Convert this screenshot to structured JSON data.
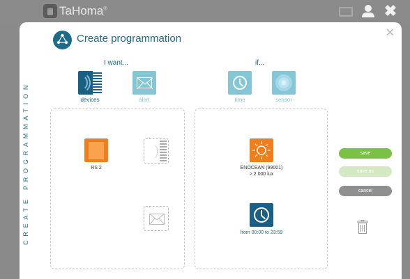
{
  "app": {
    "name": "TaHoma",
    "trademark": "®"
  },
  "topbar": {
    "icons": [
      "mail-icon",
      "user-icon",
      "close-icon"
    ],
    "close_glyph": "✖"
  },
  "dialog": {
    "title": "Create programmation",
    "close_glyph": "✕",
    "side_label": "CREATE PROGRAMMATION",
    "want": {
      "title": "I want...",
      "options": [
        {
          "label": "devices",
          "icon": "devices-icon",
          "selected": true
        },
        {
          "label": "alert",
          "icon": "envelope-icon",
          "selected": false
        }
      ]
    },
    "if": {
      "title": "if...",
      "options": [
        {
          "label": "time",
          "icon": "clock-icon",
          "selected": false
        },
        {
          "label": "sensor",
          "icon": "sensor-icon",
          "selected": false
        }
      ]
    },
    "action_panel": {
      "device": {
        "label": "RS 2",
        "icon": "rolling-shutter-icon"
      },
      "placeholders": [
        "devices-icon",
        "envelope-icon"
      ]
    },
    "condition_panel": {
      "sensor": {
        "line1": "ENOCEAN (99001)",
        "line2": "> 2 000 lux",
        "icon": "sun-icon"
      },
      "time": {
        "label": "from 00:00 to 23:59",
        "icon": "clock-icon"
      }
    },
    "buttons": {
      "save": "save",
      "save_as": "save as",
      "cancel": "cancel"
    },
    "trash_icon": "trash-icon"
  },
  "colors": {
    "brand_blue": "#1c6b8a",
    "light_blue": "#84c6d6",
    "orange": "#f07f1b",
    "save_green": "#7bc143",
    "save_as_green": "#d3e9c2",
    "cancel_gray": "#8f8f8f"
  }
}
